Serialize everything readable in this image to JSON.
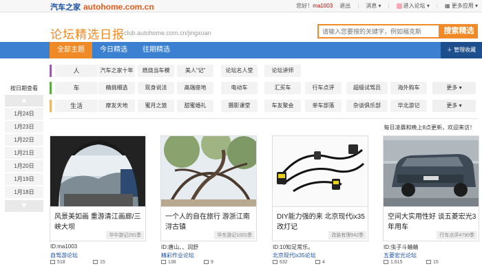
{
  "topbar": {
    "logo_cn": "汽车之家",
    "logo_en": "autohome.com.cn",
    "greeting": "您好！",
    "username": "ma1003",
    "logout": "退出",
    "messages": "消息",
    "enter_forum": "进入论坛",
    "more_apps": "更多应用"
  },
  "header": {
    "title": "论坛精选日报",
    "url": "club.autohome.com.cn/jingxuan",
    "search_placeholder": "请输入您要搜的关键字，例如福克斯",
    "search_button": "搜索精选"
  },
  "nav": {
    "tabs": [
      "全部主题",
      "今日精选",
      "往期精选"
    ],
    "manage": "管理收藏"
  },
  "categories": [
    {
      "name": "人",
      "color": "#9b59b6",
      "tags": [
        "汽车之家十年",
        "燃烧当车模",
        "美人“记”",
        "论坛名人堂",
        "论坛讲师"
      ],
      "more": ""
    },
    {
      "name": "车",
      "color": "#5aaa3f",
      "tags": [
        "精挑细选",
        "现身说法",
        "高端座地",
        "电动车",
        "汇买车",
        "行车点评",
        "超级试驾员",
        "海外购车"
      ],
      "more": "更多"
    },
    {
      "name": "生活",
      "color": "#f3b16a",
      "tags": [
        "摩友天地",
        "蜜月之旅",
        "甜蜜婚礼",
        "摄影课堂",
        "车友聚会",
        "单车部落",
        "杂谈俱乐部",
        "华北游记"
      ],
      "more": "更多"
    }
  ],
  "dates": {
    "title": "按日期查看",
    "items": [
      "1月24日",
      "1月23日",
      "1月22日",
      "1月21日",
      "1月20日",
      "1月19日",
      "1月18日"
    ]
  },
  "update_note": "每日凌晨和晚上8点更新，欢迎来访！",
  "cards": [
    {
      "title": "风景美如画 重游清江画廊/三峡大坝",
      "forum_tag": "华中游记291季",
      "author": "ID:ma1003",
      "forum": "自驾游论坛",
      "views": "518",
      "replies": "15"
    },
    {
      "title": "一个人的自在旅行 游浙江南浔古镇",
      "forum_tag": "华东游记1001季",
      "author": "ID:唐山、、润舒",
      "forum": "精彩作业论坛",
      "views": "138",
      "replies": "9"
    },
    {
      "title": "DIY能力强的来 北京现代ix35改灯记",
      "forum_tag": "改装有理942季",
      "author": "ID:10知足常乐。",
      "forum": "北京现代ix35论坛",
      "views": "632",
      "replies": "4"
    },
    {
      "title": "空间大实用性好 谈五菱宏光3年用车",
      "forum_tag": "行车点评4790季",
      "author": "ID:虫子斗蛐蛐",
      "forum": "五菱宏光论坛",
      "views": "1,615",
      "replies": "15"
    }
  ]
}
